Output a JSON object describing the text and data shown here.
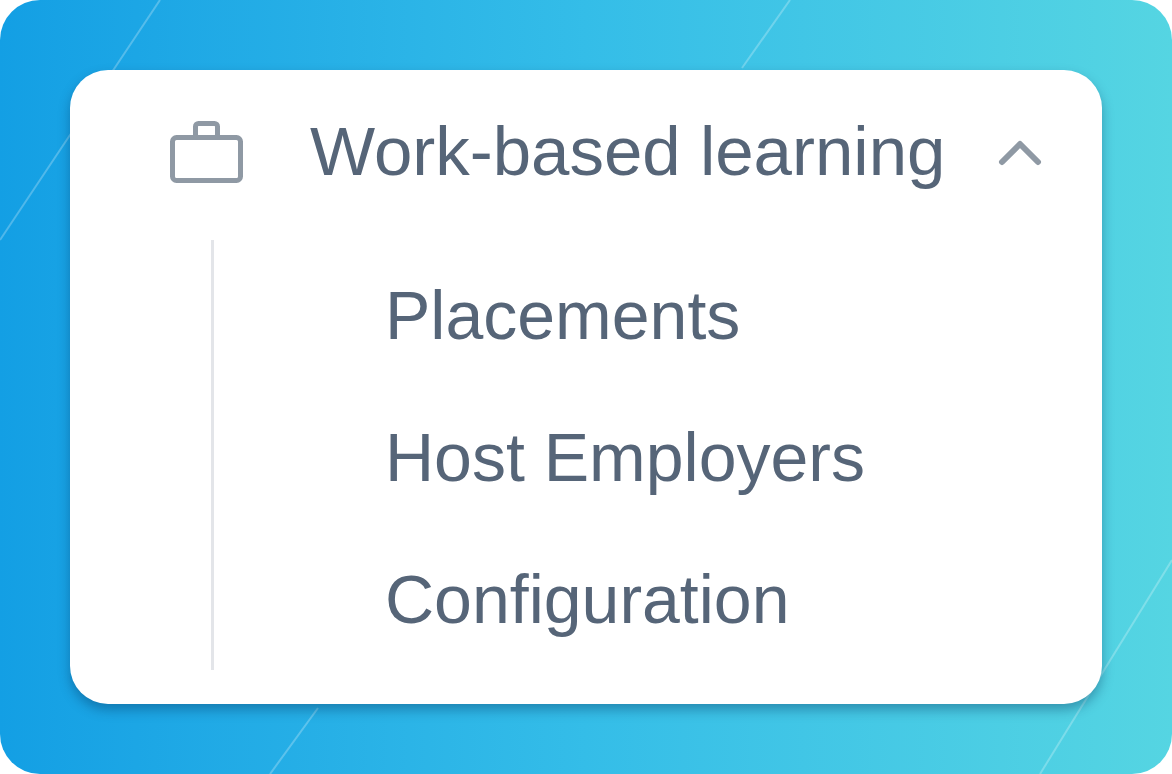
{
  "menu": {
    "title": "Work-based learning",
    "expanded": true,
    "items": [
      {
        "label": "Placements"
      },
      {
        "label": "Host Employers"
      },
      {
        "label": "Configuration"
      }
    ]
  }
}
